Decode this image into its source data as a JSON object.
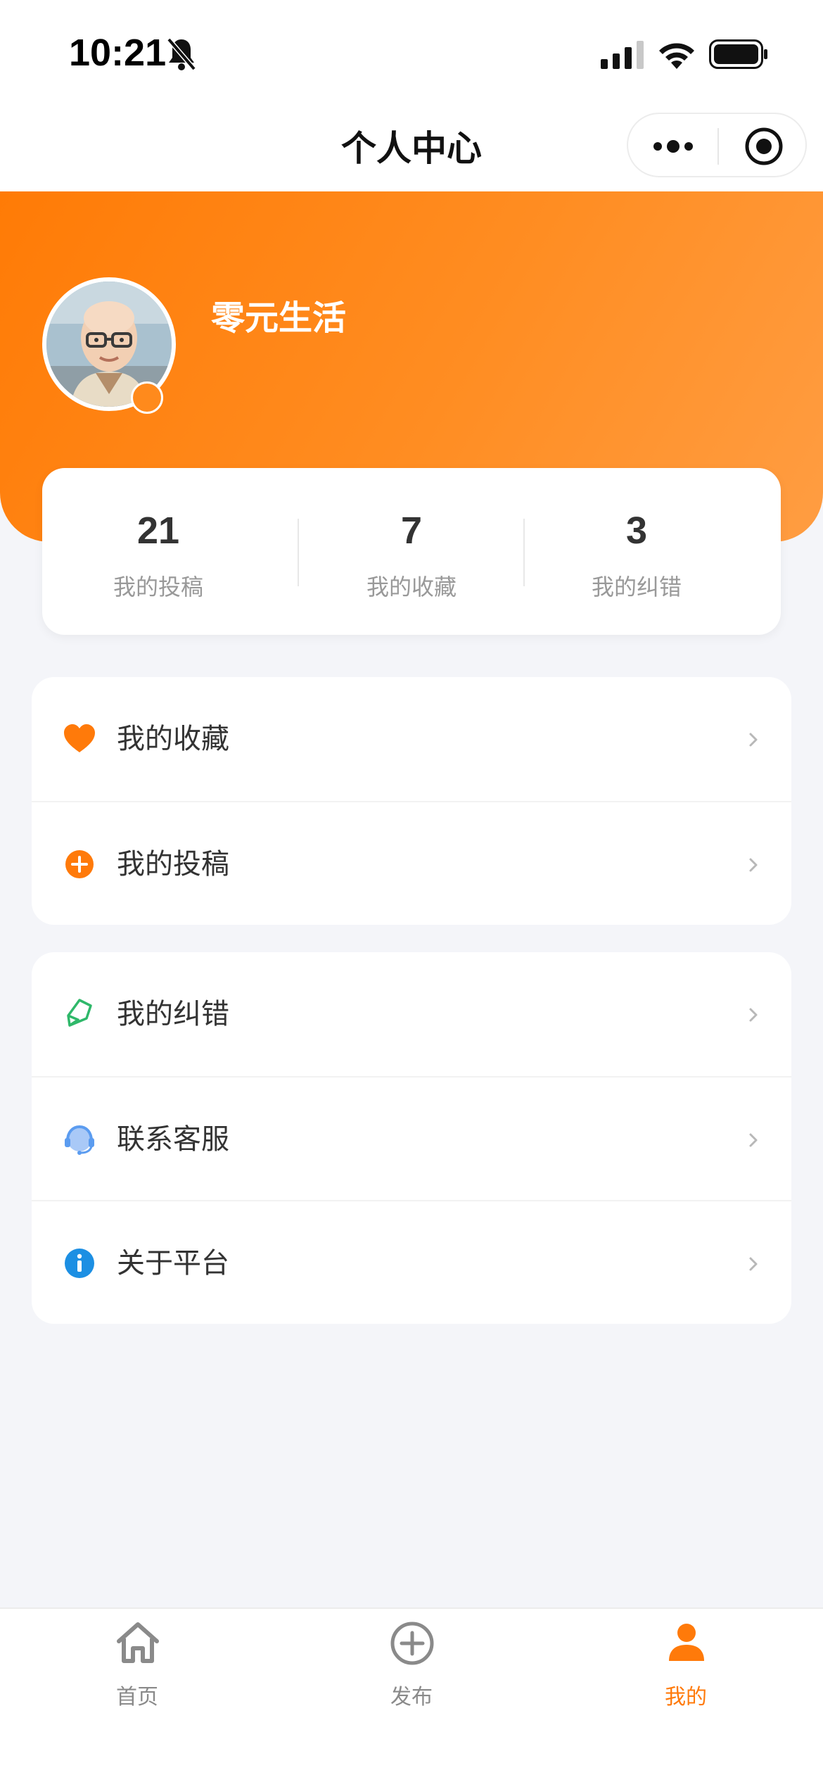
{
  "status_bar": {
    "time": "10:21",
    "icons": [
      "bell-muted-icon",
      "signal-icon",
      "wifi-icon",
      "battery-icon"
    ]
  },
  "nav": {
    "title": "个人中心",
    "capsule_icons": [
      "more-icon",
      "target-icon"
    ]
  },
  "profile": {
    "username": "零元生活",
    "avatar": "avatar"
  },
  "stats": [
    {
      "value": "21",
      "label": "我的投稿"
    },
    {
      "value": "7",
      "label": "我的收藏"
    },
    {
      "value": "3",
      "label": "我的纠错"
    }
  ],
  "menu_group_1": [
    {
      "label": "我的收藏",
      "icon": "heart-icon"
    },
    {
      "label": "我的投稿",
      "icon": "plus-circle-icon"
    }
  ],
  "menu_group_2": [
    {
      "label": "我的纠错",
      "icon": "correction-icon"
    },
    {
      "label": "联系客服",
      "icon": "headset-icon"
    },
    {
      "label": "关于平台",
      "icon": "info-icon"
    }
  ],
  "tabs": [
    {
      "label": "首页",
      "icon": "home-icon",
      "active": false
    },
    {
      "label": "发布",
      "icon": "plus-circle-icon",
      "active": false
    },
    {
      "label": "我的",
      "icon": "user-icon",
      "active": true
    }
  ],
  "colors": {
    "accent": "#ff7a0a",
    "background": "#f4f5f9",
    "correction_green": "#2fb86a",
    "headset_blue": "#5b9cf0",
    "info_blue": "#1c8fe3"
  }
}
